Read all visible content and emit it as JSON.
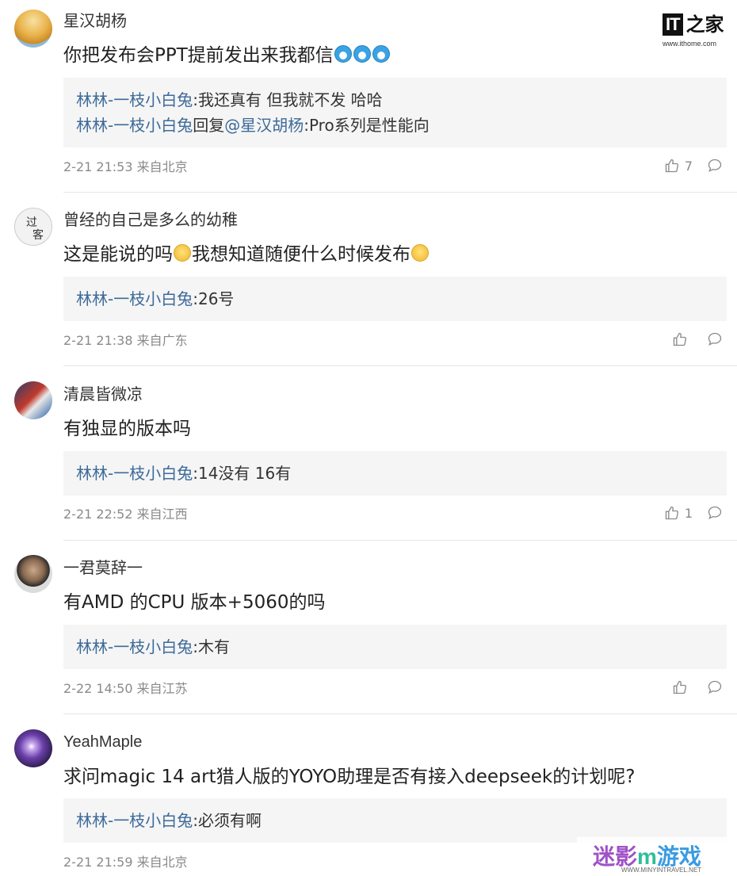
{
  "logo": {
    "mark": "IT",
    "name": "之家",
    "url": "www.ithome.com"
  },
  "comments": [
    {
      "user": "星汉胡杨",
      "text_before": "你把发布会PPT提前发出来我都信",
      "replies": [
        {
          "user": "林林-一枝小白兔",
          "sep": ":",
          "text": "我还真有 但我就不发 哈哈"
        },
        {
          "user": "林林-一枝小白兔",
          "reply_word": "回复",
          "mention": "@星汉胡杨",
          "sep": ":",
          "text": "Pro系列是性能向"
        }
      ],
      "meta": "2-21 21:53 来自北京",
      "likes": "7"
    },
    {
      "user": "曾经的自己是多么的幼稚",
      "text_before": "这是能说的吗",
      "text_after": "我想知道随便什么时候发布",
      "replies": [
        {
          "user": "林林-一枝小白兔",
          "sep": ":",
          "text": "26号"
        }
      ],
      "meta": "2-21 21:38 来自广东",
      "likes": ""
    },
    {
      "user": "清晨皆微凉",
      "text_before": "有独显的版本吗",
      "replies": [
        {
          "user": "林林-一枝小白兔",
          "sep": ":",
          "text": "14没有 16有"
        }
      ],
      "meta": "2-21 22:52 来自江西",
      "likes": "1"
    },
    {
      "user": "一君莫辞一",
      "text_before": "有AMD 的CPU 版本+5060的吗",
      "replies": [
        {
          "user": "林林-一枝小白兔",
          "sep": ":",
          "text": "木有"
        }
      ],
      "meta": "2-22 14:50 来自江苏",
      "likes": ""
    },
    {
      "user": "YeahMaple",
      "text_before": "求问magic 14 art猎人版的YOYO助理是否有接入deepseek的计划呢?",
      "replies": [
        {
          "user": "林林-一枝小白兔",
          "sep": ":",
          "text": "必须有啊"
        }
      ],
      "meta": "2-21 21:59 来自北京",
      "likes": ""
    }
  ],
  "watermark": {
    "part1": "迷影",
    "part2": "m",
    "part3": "游戏",
    "url": "WWW.MINYINTRAVEL.NET"
  },
  "colors": {
    "user_link": "#3d6a99",
    "meta": "#8a8a8a",
    "reply_bg": "#f5f5f5"
  }
}
